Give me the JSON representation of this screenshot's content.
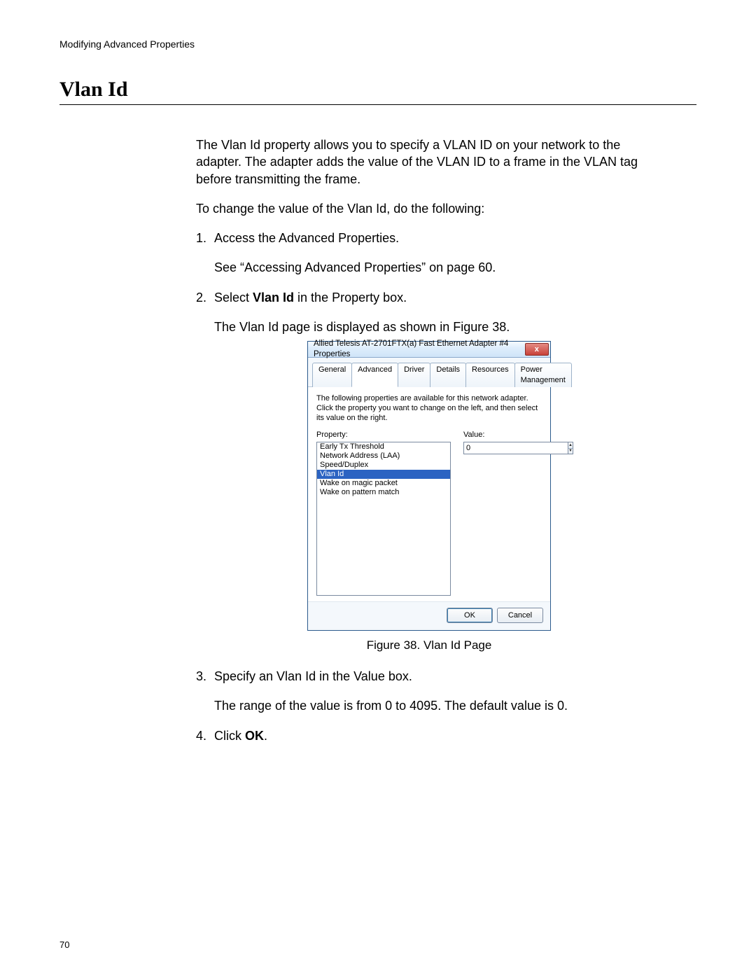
{
  "header": "Modifying Advanced Properties",
  "title": "Vlan Id",
  "intro": "The Vlan Id property allows you to specify a VLAN ID on your network to the adapter. The adapter adds the value of the VLAN ID to a frame in the VLAN tag before transmitting the frame.",
  "lead": "To change the value of the Vlan Id, do the following:",
  "steps": {
    "s1_num": "1.",
    "s1": "Access the Advanced Properties.",
    "s1_sub": "See “Accessing Advanced Properties” on page 60.",
    "s2_num": "2.",
    "s2_pre": "Select ",
    "s2_bold": "Vlan Id",
    "s2_post": " in the Property box.",
    "s2_sub": "The Vlan Id page is displayed as shown in Figure 38.",
    "s3_num": "3.",
    "s3": "Specify an Vlan Id in the Value box.",
    "s3_sub": "The range of the value is from 0 to 4095. The default value is 0.",
    "s4_num": "4.",
    "s4_pre": "Click ",
    "s4_bold": "OK",
    "s4_post": "."
  },
  "figure_caption": "Figure 38. Vlan Id Page",
  "page_number": "70",
  "dialog": {
    "title": "Allied Telesis AT-2701FTX(a) Fast Ethernet Adapter #4 Properties",
    "close_glyph": "x",
    "tabs": [
      "General",
      "Advanced",
      "Driver",
      "Details",
      "Resources",
      "Power Management"
    ],
    "active_tab_index": 1,
    "description": "The following properties are available for this network adapter. Click the property you want to change on the left, and then select its value on the right.",
    "property_label": "Property:",
    "value_label": "Value:",
    "properties": [
      "Early Tx Threshold",
      "Network Address (LAA)",
      "Speed/Duplex",
      "Vlan Id",
      "Wake on magic packet",
      "Wake on pattern match"
    ],
    "selected_property_index": 3,
    "value": "0",
    "ok": "OK",
    "cancel": "Cancel",
    "spin_up": "▲",
    "spin_down": "▼"
  }
}
